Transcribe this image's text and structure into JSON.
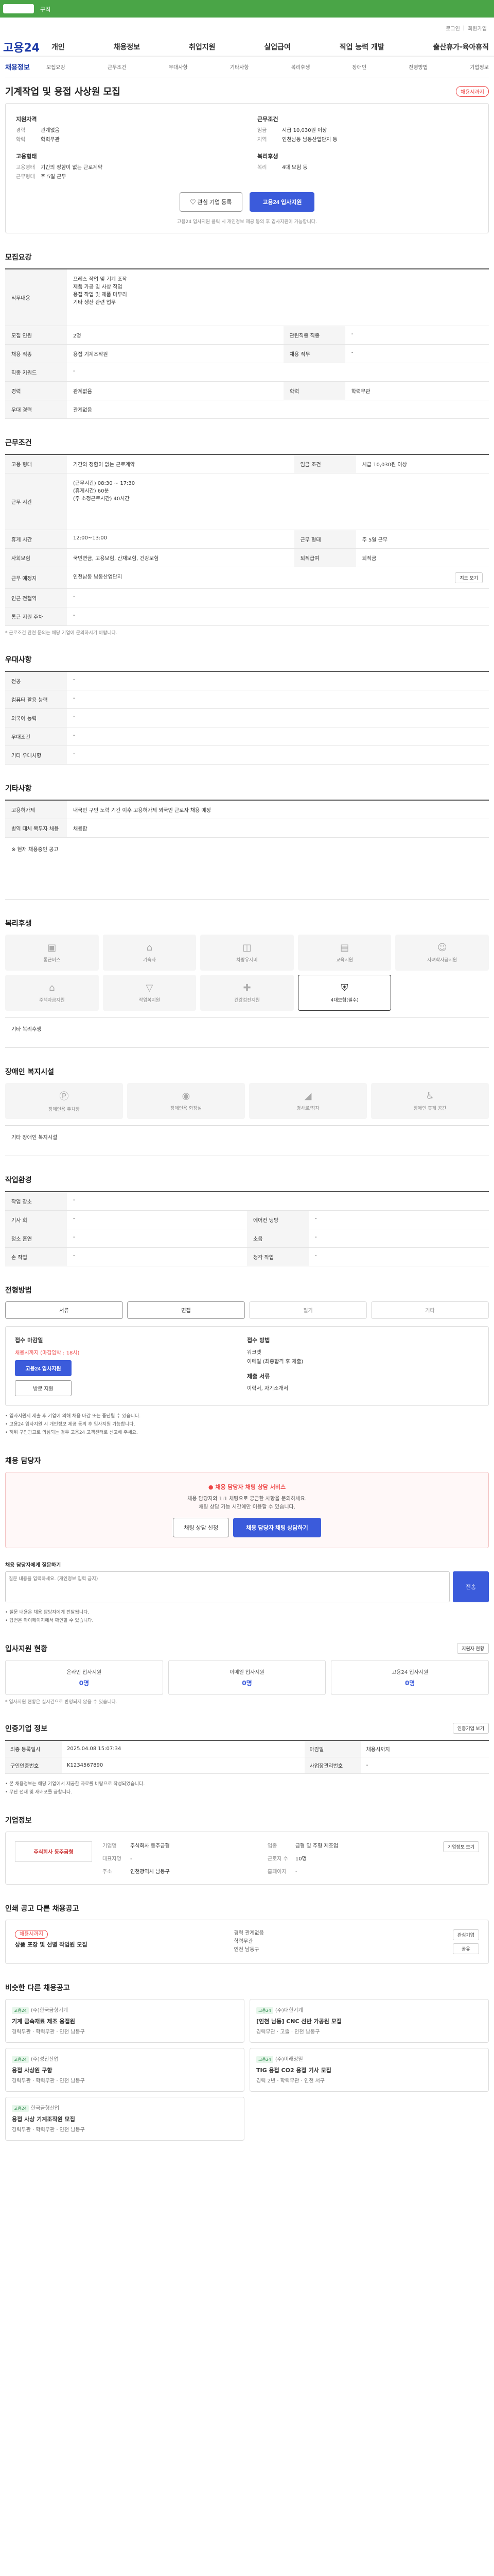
{
  "topbar": {
    "text": "구직"
  },
  "utilbar": {
    "items": [
      "로그인",
      "회원가입"
    ]
  },
  "brand": {
    "logo": "고용24"
  },
  "gnb": {
    "menu": [
      "개인",
      "채용정보",
      "취업지원",
      "실업급여",
      "직업 능력 개발",
      "출산휴가·육아휴직"
    ]
  },
  "subnav": {
    "logo": "채용정보",
    "items": [
      "모집요강",
      "근무조건",
      "우대사항",
      "기타사항",
      "복리후생",
      "장애인",
      "전형방법",
      "기업정보"
    ]
  },
  "job": {
    "title": "기계작업 및 용접 사상원 모집",
    "status": "채용시까지"
  },
  "summary": {
    "left_head": "지원자격",
    "left_rows": [
      {
        "k": "경력",
        "v": "관계없음"
      },
      {
        "k": "학력",
        "v": "학력무관"
      }
    ],
    "left_head2": "고용형태",
    "left_rows2": [
      {
        "k": "고용형태",
        "v": "기간의 정함이 없는 근로계약"
      },
      {
        "k": "근무형태",
        "v": "주 5일 근무"
      }
    ],
    "right_head": "근무조건",
    "right_rows": [
      {
        "k": "임금",
        "v": "시급 10,030원 이상"
      },
      {
        "k": "지역",
        "v": "인천남동 남동산업단지 등"
      }
    ],
    "right_head2": "복리후생",
    "right_rows2": [
      {
        "k": "복리",
        "v": "4대 보험 등"
      }
    ],
    "interest_btn": "관심 기업 등록",
    "apply_btn": "고용24 입사지원",
    "note": "고용24 입사지원 클릭 시 개인정보 제공 동의 후 입사지원이 가능합니다."
  },
  "recruit": {
    "title": "모집요강",
    "duty_label": "직무내용",
    "duty": "프레스 작업 및 기계 조작\n제품 가공 및 사상 작업\n용접 작업 및 제품 마무리\n기타 생산 관련 업무",
    "rows": [
      {
        "k": "모집 인원",
        "v": "2명",
        "k2": "관련직종 직종",
        "v2": "-"
      },
      {
        "k": "채용 직종",
        "v": "용접 기계조작원",
        "k2": "채용 직무",
        "v2": "-"
      },
      {
        "k": "직종 키워드",
        "v": "-",
        "k2": "",
        "v2": ""
      },
      {
        "k": "경력",
        "v": "관계없음",
        "k2": "학력",
        "v2": "학력무관"
      },
      {
        "k": "우대 경력",
        "v": "관계없음",
        "k2": "",
        "v2": ""
      }
    ]
  },
  "conditions": {
    "title": "근무조건",
    "rows": [
      {
        "k": "고용 형태",
        "v": "기간의 정함이 없는 근로계약",
        "k2": "임금 조건",
        "v2": "시급 10,030원 이상"
      },
      {
        "k": "근무 시간",
        "v": "(근무시간) 08:30 ~ 17:30\n(휴게시간) 60분\n(주 소정근로시간) 40시간",
        "k2": "",
        "v2": ""
      },
      {
        "k": "휴게 시간",
        "v": "12:00~13:00",
        "k2": "근무 형태",
        "v2": "주 5일 근무"
      },
      {
        "k": "사회보험",
        "v": "국민연금, 고용보험, 산재보험, 건강보험",
        "k2": "퇴직급여",
        "v2": "퇴직금"
      },
      {
        "k": "근무 예정지",
        "v": "인천남동 남동산업단지",
        "k2": "",
        "v2": ""
      },
      {
        "k": "인근 전철역",
        "v": "-",
        "k2": "",
        "v2": ""
      },
      {
        "k": "통근 지원 주차",
        "v": "-",
        "k2": "",
        "v2": ""
      }
    ],
    "map_btn": "지도 보기",
    "note": "* 근로조건 관련 문의는 해당 기업에 문의하시기 바랍니다."
  },
  "preferences": {
    "title": "우대사항",
    "rows": [
      {
        "k": "전공",
        "v": "-"
      },
      {
        "k": "컴퓨터 활용 능력",
        "v": "-"
      },
      {
        "k": "외국어 능력",
        "v": "-"
      },
      {
        "k": "우대조건",
        "v": "-"
      },
      {
        "k": "기타 우대사항",
        "v": "-"
      }
    ]
  },
  "etc": {
    "title": "기타사항",
    "rows": [
      {
        "k": "고용허가제",
        "v": "내국인 구인 노력 기간 이후 고용허가제 외국인 근로자 채용 예정"
      },
      {
        "k": "병역 대체 복무자 채용",
        "v": "채용함"
      }
    ],
    "content": "※ 현재 채용중인 공고"
  },
  "welfare": {
    "title": "복리후생",
    "items": [
      {
        "name": "통근버스",
        "icon": "bus-icon",
        "on": false
      },
      {
        "name": "기숙사",
        "icon": "home-icon",
        "on": false
      },
      {
        "name": "차량유지비",
        "icon": "car-icon",
        "on": false
      },
      {
        "name": "교육지원",
        "icon": "book-icon",
        "on": false
      },
      {
        "name": "자녀학자금지원",
        "icon": "child-icon",
        "on": false
      },
      {
        "name": "주택자금지원",
        "icon": "house-icon",
        "on": false
      },
      {
        "name": "작업복지원",
        "icon": "shirt-icon",
        "on": false
      },
      {
        "name": "건강검진지원",
        "icon": "health-icon",
        "on": false
      },
      {
        "name": "4대보험(필수)",
        "icon": "shield-icon",
        "on": true
      }
    ],
    "other_label": "기타 복리후생"
  },
  "disabled": {
    "title": "장애인 복지시설",
    "items": [
      {
        "name": "장애인용 주차장",
        "icon": "parking-icon"
      },
      {
        "name": "장애인용 화장실",
        "icon": "restroom-icon"
      },
      {
        "name": "경사로/점자",
        "icon": "ramp-icon"
      },
      {
        "name": "장애인 휴게 공간",
        "icon": "rest-icon"
      }
    ],
    "other_label": "기타 장애인 복지시설"
  },
  "workenv": {
    "title": "작업환경",
    "rows": [
      {
        "k": "작업 장소",
        "v": "-",
        "k2": "",
        "v2": ""
      },
      {
        "k": "기사 회",
        "v": "-",
        "k2": "에어컨 냉방",
        "v2": "-"
      },
      {
        "k": "청소 흡연",
        "v": "-",
        "k2": "소음",
        "v2": "-"
      },
      {
        "k": "손 작업",
        "v": "-",
        "k2": "청각 작업",
        "v2": "-"
      }
    ]
  },
  "selection": {
    "title": "전형방법",
    "methods": [
      {
        "name": "서류",
        "on": true
      },
      {
        "name": "면접",
        "on": true
      },
      {
        "name": "필기",
        "on": false
      },
      {
        "name": "기타",
        "on": false
      }
    ],
    "apply_head": "접수 마감일",
    "apply_date": "채용시까지 (마감임박 : 18시)",
    "apply_btn1": "고용24 입사지원",
    "apply_btn2": "방문 지원",
    "method_head": "접수 방법",
    "method_lines": [
      "워크넷",
      "이메일 (최종합격 후 제출)"
    ],
    "doc_head": "제출 서류",
    "doc_lines": [
      "이력서, 자기소개서"
    ],
    "bullets": [
      "입사지원서 제출 후 기업에 의해 채용 마감 또는 중단될 수 있습니다.",
      "고용24 입사지원 시 개인정보 제공 동의 후 입사지원 가능합니다.",
      "허위 구인광고로 의심되는 경우 고용24 고객센터로 신고해 주세요."
    ]
  },
  "chat": {
    "section": "채용 담당자",
    "title": "채용 담당자 채팅 상담 서비스",
    "desc": "채용 담당자와 1:1 채팅으로 궁금한 사항을 문의하세요.\n채팅 상담 가능 시간에만 이용할 수 있습니다.",
    "btn1": "채팅 상담 신청",
    "btn2": "채용 담당자 채팅 상담하기",
    "qa_label": "채용 담당자에게 질문하기",
    "qa_placeholder": "질문 내용을 입력하세요. (개인정보 입력 금지)",
    "qa_submit": "전송",
    "qa_notes": [
      "질문 내용은 채용 담당자에게 전달됩니다.",
      "답변은 마이페이지에서 확인할 수 있습니다."
    ]
  },
  "stats": {
    "title": "입사지원 현황",
    "more": "지원자 현황",
    "cards": [
      {
        "label": "온라인 입사지원",
        "value": "0명"
      },
      {
        "label": "이메일 입사지원",
        "value": "0명"
      },
      {
        "label": "고용24 입사지원",
        "value": "0명"
      }
    ],
    "note": "* 입사지원 현황은 실시간으로 반영되지 않을 수 있습니다."
  },
  "posting": {
    "title": "인증기업 정보",
    "more": "인증기업 보기",
    "rows": [
      {
        "k": "최종 등록일시",
        "v": "2025.04.08 15:07:34",
        "k2": "마감일",
        "v2": "채용시까지"
      },
      {
        "k": "구인인증번호",
        "v": "K1234567890",
        "k2": "사업장관리번호",
        "v2": "-"
      }
    ],
    "notes": [
      "본 채용정보는 해당 기업에서 제공한 자료를 바탕으로 작성되었습니다.",
      "무단 전재 및 재배포를 금합니다."
    ]
  },
  "company": {
    "title": "기업정보",
    "logo_text": "주식회사 동주금형",
    "btn": "기업정보 보기",
    "fields": [
      {
        "k": "기업명",
        "v": "주식회사 동주금형"
      },
      {
        "k": "업종",
        "v": "금형 및 주형 제조업"
      },
      {
        "k": "대표자명",
        "v": "-"
      },
      {
        "k": "근로자 수",
        "v": "10명"
      },
      {
        "k": "주소",
        "v": "인천광역시 남동구"
      },
      {
        "k": "홈페이지",
        "v": "-"
      }
    ]
  },
  "recommend": {
    "title": "인쇄 공고 다른 채용공고",
    "card_tag": "채용시까지",
    "card_title": "상품 포장 및 선별 작업원 모집",
    "card_lines": [
      "경력 관계없음",
      "학력무관",
      "인천 남동구"
    ],
    "btns": [
      "관심기업",
      "공유"
    ]
  },
  "similar": {
    "title": "비슷한 다른 채용공고",
    "items": [
      {
        "tag": "고용24",
        "company": "(주)한국금형기계",
        "title": "기계 금속재료 제조 용접원",
        "meta": "경력무관 · 학력무관 · 인천 남동구"
      },
      {
        "tag": "고용24",
        "company": "(주)대한기계",
        "title": "[인천 남동] CNC 선반 가공원 모집",
        "meta": "경력무관 · 고졸 · 인천 남동구"
      },
      {
        "tag": "고용24",
        "company": "(주)성진산업",
        "title": "용접 사상원 구함",
        "meta": "경력무관 · 학력무관 · 인천 남동구"
      },
      {
        "tag": "고용24",
        "company": "(주)미래정밀",
        "title": "TIG 용접 CO2 용접 기사 모집",
        "meta": "경력 2년 · 학력무관 · 인천 서구"
      },
      {
        "tag": "고용24",
        "company": "한국금형산업",
        "title": "용접 사상 기계조작원 모집",
        "meta": "경력무관 · 학력무관 · 인천 남동구"
      }
    ]
  }
}
